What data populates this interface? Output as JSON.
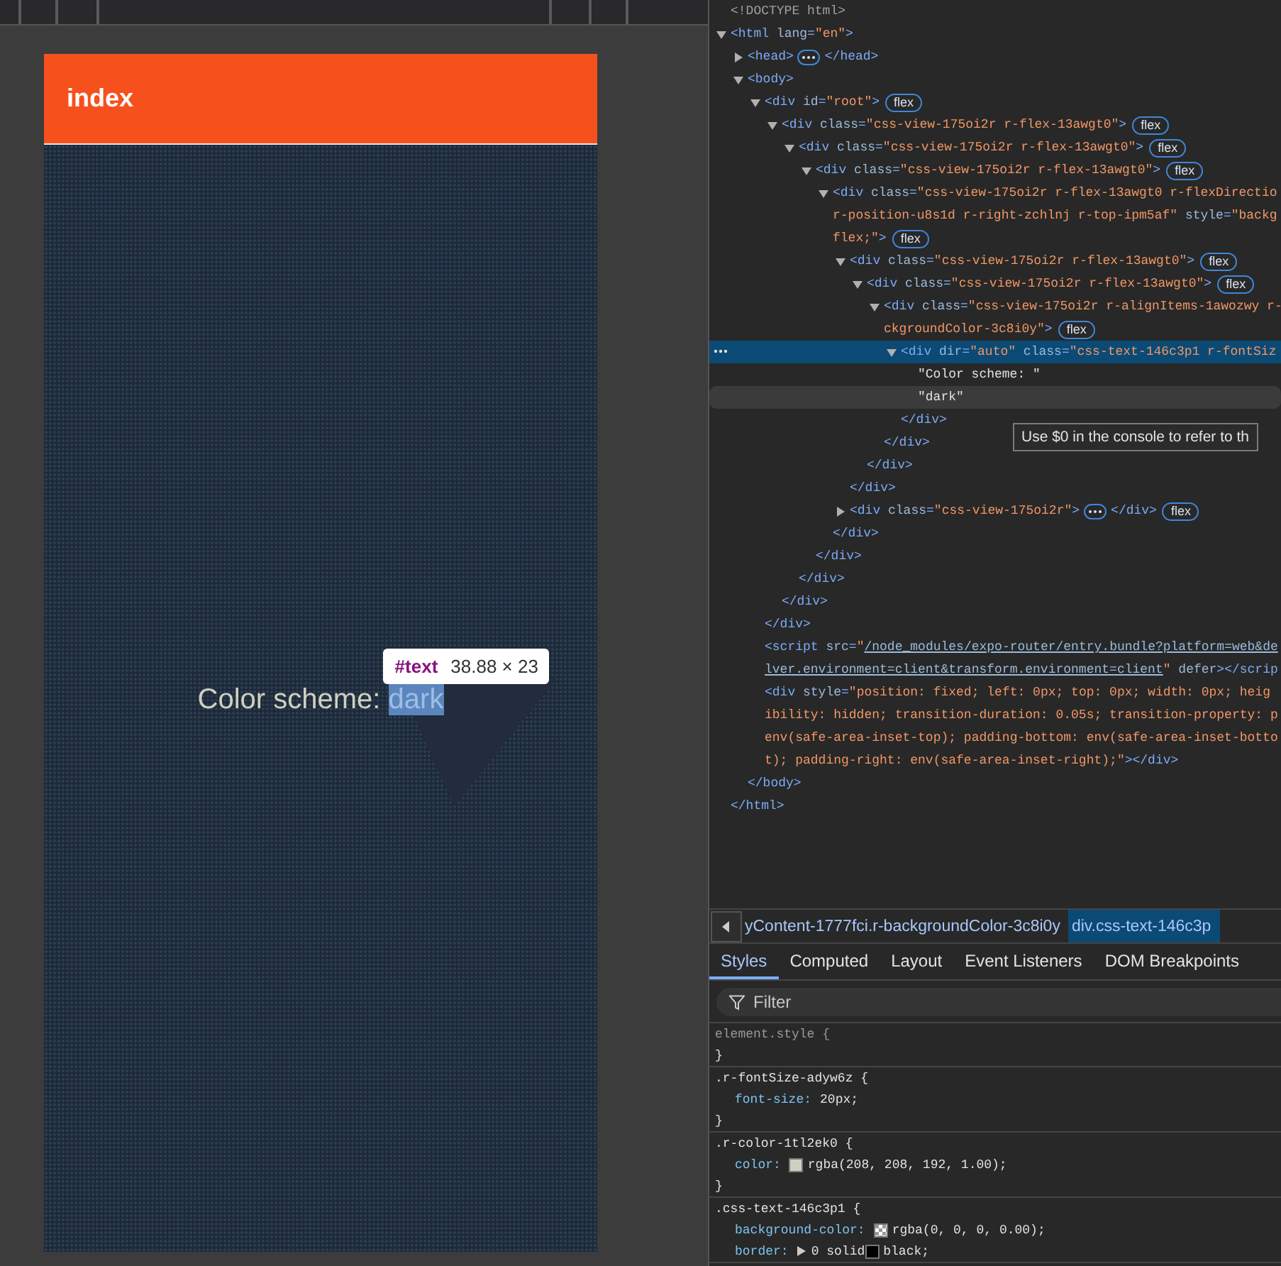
{
  "preview": {
    "header_title": "index",
    "label": "Color scheme: ",
    "value": "dark",
    "value_highlighted": true,
    "inspect_tooltip": {
      "node": "#text",
      "size": "38.88 × 23"
    }
  },
  "dom_tree": {
    "hint_tooltip": "Use $0 in the console to refer to th",
    "nodes": [
      {
        "lines": [
          [
            {
              "kind": "comment",
              "text": "<!DOCTYPE html>"
            }
          ]
        ],
        "selected": false,
        "hovered": false
      },
      {
        "lines": [
          [
            {
              "kind": "tag",
              "text": "<html"
            },
            {
              "kind": "attr",
              "text": " lang"
            },
            {
              "kind": "tag",
              "text": "="
            },
            {
              "kind": "value",
              "text": "\"en\""
            },
            {
              "kind": "tag",
              "text": ">"
            }
          ]
        ],
        "selected": false,
        "hovered": false,
        "expanded": true,
        "close": [
          {
            "kind": "tag",
            "text": "</html>"
          }
        ],
        "children": [
          {
            "lines": [
              [
                {
                  "kind": "tag",
                  "text": "<head>"
                }
              ]
            ],
            "selected": false,
            "hovered": false,
            "expanded": false,
            "tail": [
              {
                "kind": "tag",
                "text": "</head>"
              }
            ]
          },
          {
            "lines": [
              [
                {
                  "kind": "tag",
                  "text": "<body>"
                }
              ]
            ],
            "selected": false,
            "hovered": false,
            "expanded": true,
            "close": [
              {
                "kind": "tag",
                "text": "</body>"
              }
            ],
            "children": [
              {
                "lines": [
                  [
                    {
                      "kind": "tag",
                      "text": "<div"
                    },
                    {
                      "kind": "attr",
                      "text": " id"
                    },
                    {
                      "kind": "tag",
                      "text": "="
                    },
                    {
                      "kind": "value",
                      "text": "\"root\""
                    },
                    {
                      "kind": "tag",
                      "text": ">"
                    }
                  ]
                ],
                "badge": "flex",
                "selected": false,
                "hovered": false,
                "expanded": true,
                "close": [
                  {
                    "kind": "tag",
                    "text": "</div>"
                  }
                ],
                "children": [
                  {
                    "lines": [
                      [
                        {
                          "kind": "tag",
                          "text": "<div"
                        },
                        {
                          "kind": "attr",
                          "text": " class"
                        },
                        {
                          "kind": "tag",
                          "text": "="
                        },
                        {
                          "kind": "value",
                          "text": "\"css-view-175oi2r r-flex-13awgt0\""
                        },
                        {
                          "kind": "tag",
                          "text": ">"
                        }
                      ]
                    ],
                    "badge": "flex",
                    "selected": false,
                    "hovered": false,
                    "expanded": true,
                    "close": [
                      {
                        "kind": "tag",
                        "text": "</div>"
                      }
                    ],
                    "children": [
                      {
                        "lines": [
                          [
                            {
                              "kind": "tag",
                              "text": "<div"
                            },
                            {
                              "kind": "attr",
                              "text": " class"
                            },
                            {
                              "kind": "tag",
                              "text": "="
                            },
                            {
                              "kind": "value",
                              "text": "\"css-view-175oi2r r-flex-13awgt0\""
                            },
                            {
                              "kind": "tag",
                              "text": ">"
                            }
                          ]
                        ],
                        "badge": "flex",
                        "selected": false,
                        "hovered": false,
                        "expanded": true,
                        "close": [
                          {
                            "kind": "tag",
                            "text": "</div>"
                          }
                        ],
                        "children": [
                          {
                            "lines": [
                              [
                                {
                                  "kind": "tag",
                                  "text": "<div"
                                },
                                {
                                  "kind": "attr",
                                  "text": " class"
                                },
                                {
                                  "kind": "tag",
                                  "text": "="
                                },
                                {
                                  "kind": "value",
                                  "text": "\"css-view-175oi2r r-flex-13awgt0\""
                                },
                                {
                                  "kind": "tag",
                                  "text": ">"
                                }
                              ]
                            ],
                            "badge": "flex",
                            "selected": false,
                            "hovered": false,
                            "expanded": true,
                            "close": [
                              {
                                "kind": "tag",
                                "text": "</div>"
                              }
                            ],
                            "children": [
                              {
                                "lines": [
                                  [
                                    {
                                      "kind": "tag",
                                      "text": "<div"
                                    },
                                    {
                                      "kind": "attr",
                                      "text": " class"
                                    },
                                    {
                                      "kind": "tag",
                                      "text": "="
                                    },
                                    {
                                      "kind": "value",
                                      "text": "\"css-view-175oi2r r-flex-13awgt0 r-flexDirectio"
                                    }
                                  ],
                                  [
                                    {
                                      "kind": "value",
                                      "text": "r-position-u8s1d r-right-zchlnj r-top-ipm5af\""
                                    },
                                    {
                                      "kind": "attr",
                                      "text": " style"
                                    },
                                    {
                                      "kind": "tag",
                                      "text": "="
                                    },
                                    {
                                      "kind": "value",
                                      "text": "\"backg"
                                    }
                                  ],
                                  [
                                    {
                                      "kind": "value",
                                      "text": "flex;\""
                                    },
                                    {
                                      "kind": "tag",
                                      "text": ">"
                                    }
                                  ]
                                ],
                                "badge": "flex",
                                "selected": false,
                                "hovered": false,
                                "expanded": true,
                                "close": [
                                  {
                                    "kind": "tag",
                                    "text": "</div>"
                                  }
                                ],
                                "children": [
                                  {
                                    "lines": [
                                      [
                                        {
                                          "kind": "tag",
                                          "text": "<div"
                                        },
                                        {
                                          "kind": "attr",
                                          "text": " class"
                                        },
                                        {
                                          "kind": "tag",
                                          "text": "="
                                        },
                                        {
                                          "kind": "value",
                                          "text": "\"css-view-175oi2r r-flex-13awgt0\""
                                        },
                                        {
                                          "kind": "tag",
                                          "text": ">"
                                        }
                                      ]
                                    ],
                                    "badge": "flex",
                                    "selected": false,
                                    "hovered": false,
                                    "expanded": true,
                                    "close": [
                                      {
                                        "kind": "tag",
                                        "text": "</div>"
                                      }
                                    ],
                                    "children": [
                                      {
                                        "lines": [
                                          [
                                            {
                                              "kind": "tag",
                                              "text": "<div"
                                            },
                                            {
                                              "kind": "attr",
                                              "text": " class"
                                            },
                                            {
                                              "kind": "tag",
                                              "text": "="
                                            },
                                            {
                                              "kind": "value",
                                              "text": "\"css-view-175oi2r r-flex-13awgt0\""
                                            },
                                            {
                                              "kind": "tag",
                                              "text": ">"
                                            }
                                          ]
                                        ],
                                        "badge": "flex",
                                        "selected": false,
                                        "hovered": false,
                                        "expanded": true,
                                        "close": [
                                          {
                                            "kind": "tag",
                                            "text": "</div>"
                                          }
                                        ],
                                        "children": [
                                          {
                                            "lines": [
                                              [
                                                {
                                                  "kind": "tag",
                                                  "text": "<div"
                                                },
                                                {
                                                  "kind": "attr",
                                                  "text": " class"
                                                },
                                                {
                                                  "kind": "tag",
                                                  "text": "="
                                                },
                                                {
                                                  "kind": "value",
                                                  "text": "\"css-view-175oi2r r-alignItems-1awozwy r-"
                                                }
                                              ],
                                              [
                                                {
                                                  "kind": "value",
                                                  "text": "ckgroundColor-3c8i0y\""
                                                },
                                                {
                                                  "kind": "tag",
                                                  "text": ">"
                                                }
                                              ]
                                            ],
                                            "badge": "flex",
                                            "selected": false,
                                            "hovered": false,
                                            "expanded": true,
                                            "close": [
                                              {
                                                "kind": "tag",
                                                "text": "</div>"
                                              }
                                            ],
                                            "children": [
                                              {
                                                "lines": [
                                                  [
                                                    {
                                                      "kind": "tag",
                                                      "text": "<div"
                                                    },
                                                    {
                                                      "kind": "attr",
                                                      "text": " dir"
                                                    },
                                                    {
                                                      "kind": "tag",
                                                      "text": "="
                                                    },
                                                    {
                                                      "kind": "value",
                                                      "text": "\"auto\""
                                                    },
                                                    {
                                                      "kind": "attr",
                                                      "text": " class"
                                                    },
                                                    {
                                                      "kind": "tag",
                                                      "text": "="
                                                    },
                                                    {
                                                      "kind": "value",
                                                      "text": "\"css-text-146c3p1 r-fontSiz"
                                                    }
                                                  ]
                                                ],
                                                "selected": true,
                                                "hovered": false,
                                                "expanded": true,
                                                "close": [
                                                  {
                                                    "kind": "tag",
                                                    "text": "</div>"
                                                  }
                                                ],
                                                "children": [
                                                  {
                                                    "lines": [
                                                      [
                                                        {
                                                          "kind": "text",
                                                          "text": "\"Color scheme: \""
                                                        }
                                                      ]
                                                    ],
                                                    "selected": false,
                                                    "hovered": false
                                                  },
                                                  {
                                                    "lines": [
                                                      [
                                                        {
                                                          "kind": "text",
                                                          "text": "\"dark\""
                                                        }
                                                      ]
                                                    ],
                                                    "selected": false,
                                                    "hovered": true
                                                  }
                                                ]
                                              }
                                            ]
                                          }
                                        ]
                                      }
                                    ]
                                  },
                                  {
                                    "lines": [
                                      [
                                        {
                                          "kind": "tag",
                                          "text": "<div"
                                        },
                                        {
                                          "kind": "attr",
                                          "text": " class"
                                        },
                                        {
                                          "kind": "tag",
                                          "text": "="
                                        },
                                        {
                                          "kind": "value",
                                          "text": "\"css-view-175oi2r\""
                                        },
                                        {
                                          "kind": "tag",
                                          "text": ">"
                                        }
                                      ]
                                    ],
                                    "badge": "flex",
                                    "selected": false,
                                    "hovered": false,
                                    "expanded": false,
                                    "tail": [
                                      {
                                        "kind": "tag",
                                        "text": "</div>"
                                      }
                                    ]
                                  }
                                ]
                              }
                            ]
                          }
                        ]
                      }
                    ]
                  }
                ]
              },
              {
                "lines": [
                  [
                    {
                      "kind": "tag",
                      "text": "<script"
                    },
                    {
                      "kind": "attr",
                      "text": " src"
                    },
                    {
                      "kind": "tag",
                      "text": "="
                    },
                    {
                      "kind": "value",
                      "text": "\""
                    },
                    {
                      "kind": "link",
                      "text": "/node_modules/expo-router/entry.bundle?platform=web&de"
                    }
                  ],
                  [
                    {
                      "kind": "link",
                      "text": "lver.environment=client&transform.environment=client"
                    },
                    {
                      "kind": "value",
                      "text": "\""
                    },
                    {
                      "kind": "attr",
                      "text": " defer"
                    },
                    {
                      "kind": "tag",
                      "text": "></scrip"
                    }
                  ]
                ],
                "selected": false,
                "hovered": false
              },
              {
                "lines": [
                  [
                    {
                      "kind": "tag",
                      "text": "<div"
                    },
                    {
                      "kind": "attr",
                      "text": " style"
                    },
                    {
                      "kind": "tag",
                      "text": "="
                    },
                    {
                      "kind": "value",
                      "text": "\"position: fixed; left: 0px; top: 0px; width: 0px; heig"
                    }
                  ],
                  [
                    {
                      "kind": "value",
                      "text": "ibility: hidden; transition-duration: 0.05s; transition-property: p"
                    }
                  ],
                  [
                    {
                      "kind": "value",
                      "text": "env(safe-area-inset-top); padding-bottom: env(safe-area-inset-botto"
                    }
                  ],
                  [
                    {
                      "kind": "value",
                      "text": "t); padding-right: env(safe-area-inset-right);\""
                    },
                    {
                      "kind": "tag",
                      "text": "></div>"
                    }
                  ]
                ],
                "selected": false,
                "hovered": false
              }
            ]
          }
        ]
      }
    ]
  },
  "breadcrumbs": [
    {
      "label": "yContent-1777fci.r-backgroundColor-3c8i0y",
      "selected": false
    },
    {
      "label": "div.css-text-146c3p",
      "selected": true
    }
  ],
  "tabs": [
    {
      "label": "Styles",
      "selected": true
    },
    {
      "label": "Computed",
      "selected": false
    },
    {
      "label": "Layout",
      "selected": false
    },
    {
      "label": "Event Listeners",
      "selected": false
    },
    {
      "label": "DOM Breakpoints",
      "selected": false
    }
  ],
  "filter": {
    "placeholder": "Filter"
  },
  "rules": [
    {
      "kind": "inline",
      "selector": "element.style {",
      "close": "}"
    },
    {
      "kind": "class",
      "selector": ".r-fontSize-adyw6z {",
      "close": "}",
      "declarations": [
        {
          "property": "font-size:",
          "parts": [
            {
              "kind": "text",
              "text": "20px;"
            }
          ]
        }
      ]
    },
    {
      "kind": "class",
      "selector": ".r-color-1tl2ek0 {",
      "close": "}",
      "declarations": [
        {
          "property": "color:",
          "parts": [
            {
              "kind": "swatch",
              "color": "#d0d0c0"
            },
            {
              "kind": "text",
              "text": "rgba(208, 208, 192, 1.00);"
            }
          ]
        }
      ]
    },
    {
      "kind": "class",
      "selector": ".css-text-146c3p1 {",
      "declarations": [
        {
          "property": "background-color:",
          "parts": [
            {
              "kind": "transparent_swatch"
            },
            {
              "kind": "text",
              "text": "rgba(0, 0, 0, 0.00);"
            }
          ]
        },
        {
          "property": "border:",
          "parts": [
            {
              "kind": "expander"
            },
            {
              "kind": "text",
              "text": "0 solid"
            },
            {
              "kind": "swatch",
              "color": "#000000"
            },
            {
              "kind": "text",
              "text": "black;"
            }
          ]
        }
      ]
    }
  ]
}
